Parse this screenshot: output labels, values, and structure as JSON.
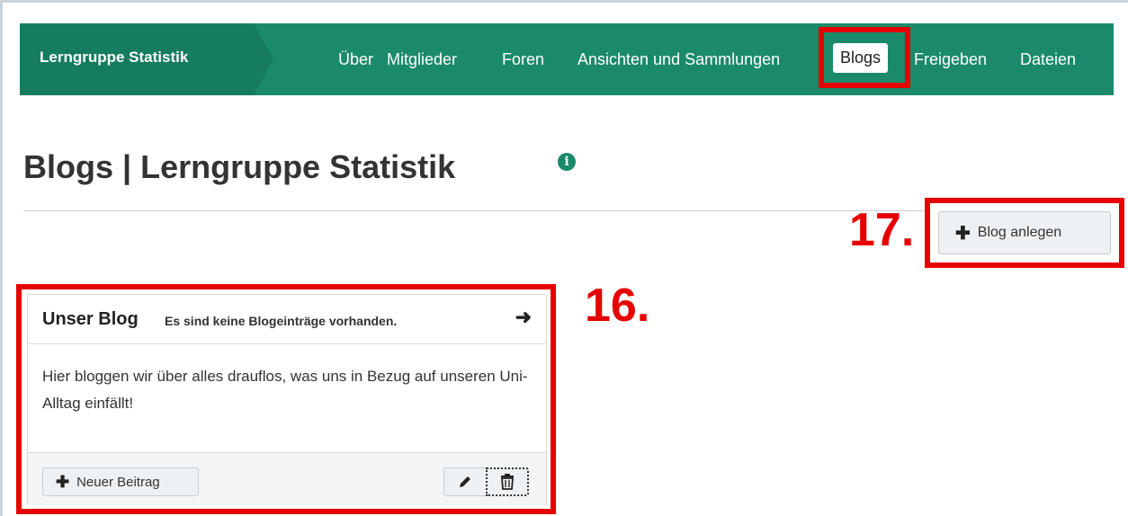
{
  "group": {
    "name": "Lerngruppe Statistik"
  },
  "nav": {
    "items": [
      {
        "label": "Über"
      },
      {
        "label": "Mitglieder"
      },
      {
        "label": "Foren"
      },
      {
        "label": "Ansichten und Sammlungen"
      },
      {
        "label": "Blogs",
        "active": true
      },
      {
        "label": "Freigeben"
      },
      {
        "label": "Dateien"
      }
    ]
  },
  "page": {
    "title": "Blogs | Lerngruppe Statistik"
  },
  "actions": {
    "create_blog_label": "Blog anlegen"
  },
  "blog": {
    "title": "Unser Blog",
    "status": "Es sind keine Blogeinträge vorhanden.",
    "description": "Hier bloggen wir über alles drauflos, was uns in Bezug auf unseren Uni-Alltag einfällt!",
    "new_entry_label": "Neuer Beitrag"
  },
  "annotations": {
    "create_blog": "17.",
    "blog_card": "16."
  },
  "colors": {
    "groupbar": "#1a8a6a",
    "highlight": "#e60000"
  },
  "icons": {
    "info": "info-icon",
    "plus": "plus-icon",
    "arrow": "arrow-right-icon",
    "edit": "pencil-icon",
    "delete": "trash-icon"
  }
}
